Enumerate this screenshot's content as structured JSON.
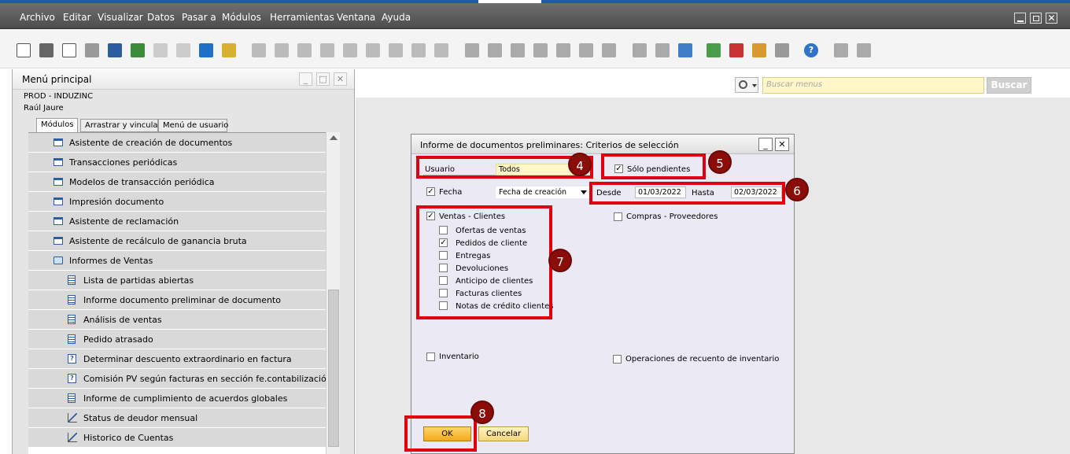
{
  "menubar": {
    "items": [
      "Archivo",
      "Editar",
      "Visualizar",
      "Datos",
      "Pasar a",
      "Módulos",
      "Herramientas",
      "Ventana",
      "Ayuda"
    ]
  },
  "main_menu": {
    "title": "Menú principal",
    "company": "PROD - INDUZINC",
    "user": "Raúl Jaure",
    "tabs": [
      "Módulos",
      "Arrastrar y vincular",
      "Menú de usuario"
    ],
    "items": [
      {
        "label": "Asistente de creación de documentos",
        "icon": "window-icon",
        "indent": 0
      },
      {
        "label": "Transacciones periódicas",
        "icon": "window-icon",
        "indent": 0
      },
      {
        "label": "Modelos de transacción periódica",
        "icon": "window-icon",
        "indent": 0
      },
      {
        "label": "Impresión documento",
        "icon": "window-icon",
        "indent": 0
      },
      {
        "label": "Asistente de reclamación",
        "icon": "window-icon",
        "indent": 0
      },
      {
        "label": "Asistente de recálculo de ganancia bruta",
        "icon": "window-icon",
        "indent": 0
      },
      {
        "label": "Informes de Ventas",
        "icon": "folder-open-icon",
        "indent": 0
      },
      {
        "label": "Lista de partidas abiertas",
        "icon": "report-icon",
        "indent": 1
      },
      {
        "label": "Informe documento preliminar de documento",
        "icon": "report-icon",
        "indent": 1
      },
      {
        "label": "Análisis de ventas",
        "icon": "report-icon",
        "indent": 1
      },
      {
        "label": "Pedido atrasado",
        "icon": "report-icon",
        "indent": 1
      },
      {
        "label": "Determinar descuento extraordinario en factura",
        "icon": "query-icon",
        "indent": 1
      },
      {
        "label": "Comisión PV según facturas en sección fe.contabilización",
        "icon": "query-icon",
        "indent": 1
      },
      {
        "label": "Informe de cumplimiento de acuerdos globales",
        "icon": "report-icon",
        "indent": 1
      },
      {
        "label": "Status de deudor mensual",
        "icon": "chart-icon",
        "indent": 1
      },
      {
        "label": "Historico de Cuentas",
        "icon": "chart-icon",
        "indent": 1
      }
    ]
  },
  "search": {
    "placeholder": "Buscar menus",
    "button": "Buscar"
  },
  "dialog": {
    "title": "Informe de documentos preliminares: Criterios de selección",
    "usuario_label": "Usuario",
    "usuario_value": "Todos",
    "solo_pendientes": "Sólo pendientes",
    "solo_pendientes_checked": true,
    "fecha_label": "Fecha",
    "fecha_checked": true,
    "fecha_type": "Fecha de creación",
    "desde_label": "Desde",
    "desde_value": "01/03/2022",
    "hasta_label": "Hasta",
    "hasta_value": "02/03/2022",
    "ventas_label": "Ventas - Clientes",
    "ventas_checked": true,
    "ventas_items": [
      {
        "label": "Ofertas de ventas",
        "checked": false
      },
      {
        "label": "Pedidos de cliente",
        "checked": true
      },
      {
        "label": "Entregas",
        "checked": false
      },
      {
        "label": "Devoluciones",
        "checked": false
      },
      {
        "label": "Anticipo de clientes",
        "checked": false
      },
      {
        "label": "Facturas clientes",
        "checked": false
      },
      {
        "label": "Notas de crédito clientes",
        "checked": false
      }
    ],
    "compras_label": "Compras - Proveedores",
    "compras_checked": false,
    "inventario_label": "Inventario",
    "inventario_checked": false,
    "operaciones_label": "Operaciones de recuento de inventario",
    "operaciones_checked": false,
    "ok": "OK",
    "cancel": "Cancelar"
  },
  "annotations": [
    "4",
    "5",
    "6",
    "7",
    "8"
  ],
  "colors": {
    "highlight": "#e1000f",
    "badge": "#8a0d0a",
    "menubar": "#5a5a5a",
    "field": "#fff7c8"
  }
}
